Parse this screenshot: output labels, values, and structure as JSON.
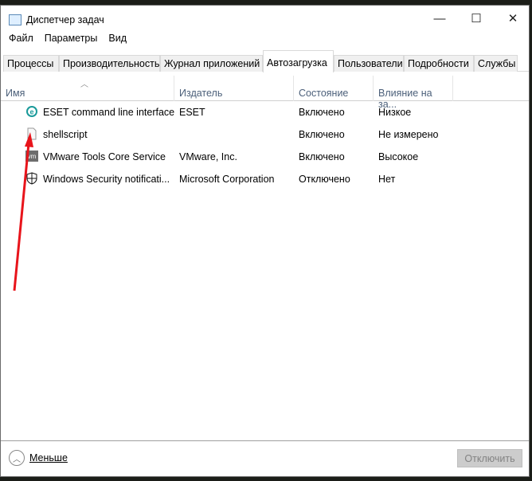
{
  "window": {
    "title": "Диспетчер задач",
    "minimize": "—",
    "maximize": "☐",
    "close": "✕"
  },
  "menu": [
    "Файл",
    "Параметры",
    "Вид"
  ],
  "tabs": [
    "Процессы",
    "Производительность",
    "Журнал приложений",
    "Автозагрузка",
    "Пользователи",
    "Подробности",
    "Службы"
  ],
  "columns": [
    "Имя",
    "Издатель",
    "Состояние",
    "Влияние на за..."
  ],
  "rows": [
    {
      "name": "ESET command line interface",
      "publisher": "ESET",
      "status": "Включено",
      "impact": "Низкое",
      "icon": "eset-icon"
    },
    {
      "name": "shellscript",
      "publisher": "",
      "status": "Включено",
      "impact": "Не измерено",
      "icon": "file-icon"
    },
    {
      "name": "VMware Tools Core Service",
      "publisher": "VMware, Inc.",
      "status": "Включено",
      "impact": "Высокое",
      "icon": "vmware-icon"
    },
    {
      "name": "Windows Security notificati...",
      "publisher": "Microsoft Corporation",
      "status": "Отключено",
      "impact": "Нет",
      "icon": "shield-icon"
    }
  ],
  "footer": {
    "less": "Меньше",
    "disable": "Отключить"
  },
  "colors": {
    "annotation": "#e8141b",
    "header_text": "#4c607a"
  }
}
